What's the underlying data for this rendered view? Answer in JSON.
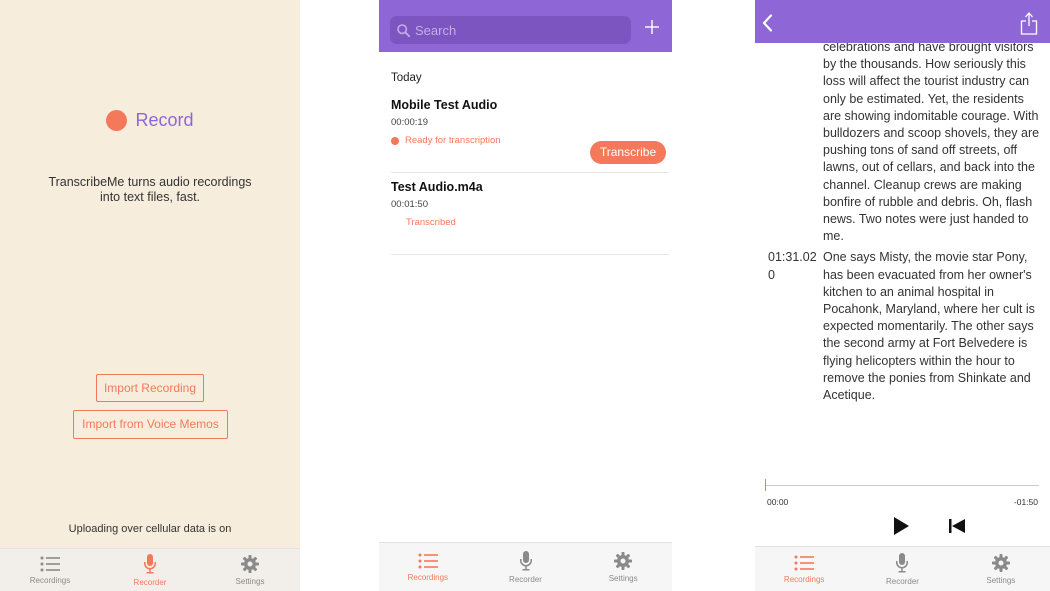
{
  "colors": {
    "accent_purple": "#8f66d6",
    "accent_orange": "#f4795b",
    "cream_background": "#f7eddc"
  },
  "tabbar": {
    "recordings_label": "Recordings",
    "recorder_label": "Recorder",
    "settings_label": "Settings",
    "icons": [
      "list-icon",
      "microphone-icon",
      "gear-icon"
    ]
  },
  "recorder_screen": {
    "record_label": "Record",
    "tagline_line1": "TranscribeMe turns audio recordings",
    "tagline_line2": "into text files, fast.",
    "import_recording_label": "Import Recording",
    "import_voice_memos_label": "Import from Voice Memos",
    "cellular_note": "Uploading over cellular data is on",
    "active_tab": "Recorder"
  },
  "recordings_screen": {
    "search_placeholder": "Search",
    "add_icon": "plus-icon",
    "section_title": "Today",
    "items": [
      {
        "title": "Mobile Test Audio",
        "duration": "00:00:19",
        "status": "Ready for transcription",
        "action_label": "Transcribe"
      },
      {
        "title": "Test Audio.m4a",
        "duration": "00:01:50",
        "status": "Transcribed"
      }
    ],
    "active_tab": "Recordings"
  },
  "transcript_screen": {
    "segments": [
      {
        "timestamp": "",
        "text": "celebrations and have brought visitors by the thousands. How seriously this loss will affect the tourist industry can only be estimated. Yet, the residents are showing indomitable courage. With bulldozers and scoop shovels, they are pushing tons of sand off streets, off lawns, out of cellars, and back into the channel. Cleanup crews are making bonfire of rubble and debris. Oh, flash news. Two notes were just handed to me."
      },
      {
        "timestamp": "01:31.020",
        "text": "One says Misty, the movie star Pony, has been evacuated from her owner's kitchen to an animal hospital in Pocahonk, Maryland, where her cult is expected momentarily. The other says the second army at Fort Belvedere is flying helicopters within the hour to remove the ponies from Shinkate and Acetique."
      }
    ],
    "elapsed": "00:00",
    "remaining": "-01:50",
    "playback_progress": 0,
    "active_tab": "Recordings"
  }
}
